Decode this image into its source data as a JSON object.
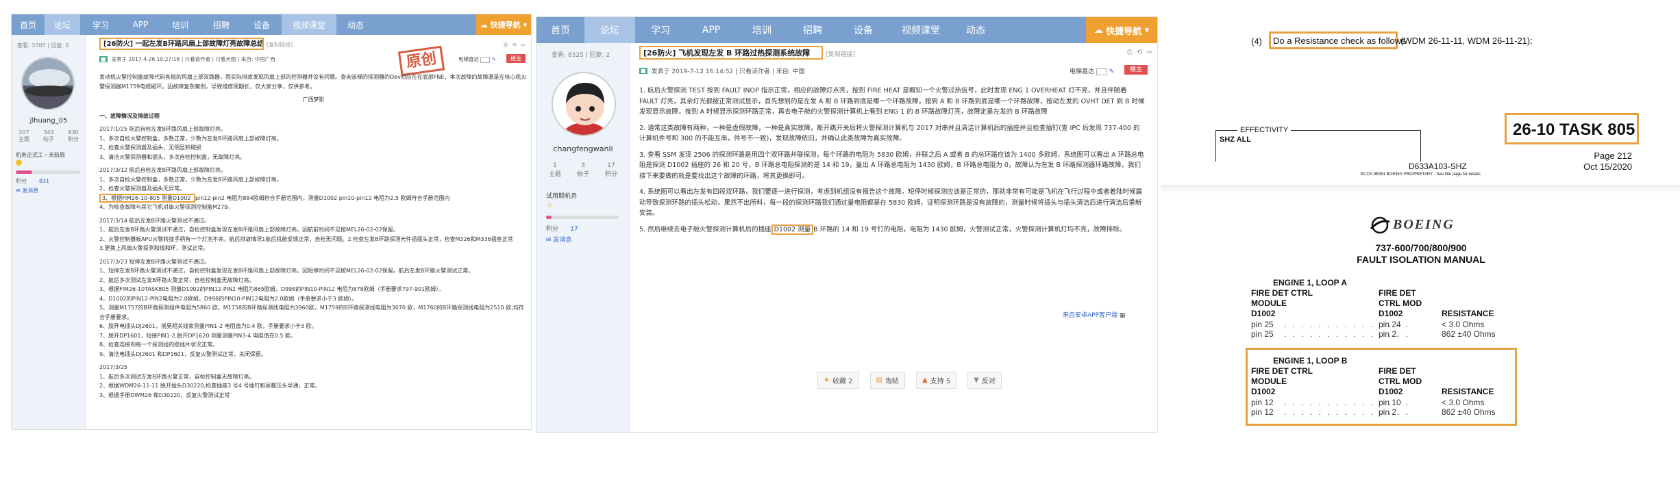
{
  "left_post": {
    "nav": [
      "首页",
      "论坛",
      "学习",
      "APP",
      "培训",
      "招聘",
      "设备",
      "视频课堂",
      "动态"
    ],
    "quick_nav": "快捷导航",
    "stats_line": "查看: 3705 | 回复: 6",
    "title": "[26防火] 一起左发B环路风扇上部故障灯亮故障总结",
    "copy_link": "[复制链接]",
    "meta": "发表于 2017-4-26 10:27:18 | 只看该作者 | 只看大图 | 来自: 中国广西",
    "stamp": "原创",
    "eyes": "电梯直达",
    "floor": "楼主",
    "username": "jlhuang_05",
    "stats": [
      {
        "v": "207",
        "l": "主题"
      },
      {
        "v": "343",
        "l": "帖子"
      },
      {
        "v": "830",
        "l": "积分"
      }
    ],
    "rank": "机务正式工・天航局",
    "credit_label": "积分",
    "credit_value": "831",
    "send_msg": "发消息",
    "intro": "发动机火警控制盒故障代码各报的风扇上部双路器，而实际排故发现风扇上部的控测器并没有问题。查询该梯的探测器的Dev对应在在底部FNE，本次故障的故障源是左核心机火警探测器M1759电缆磁环。因故障复杂案例，导致维修周期长，仅大家分享，仅供参考。",
    "sign": "广西梦影",
    "sections": [
      {
        "h": "一、故障情况及排故过程",
        "lines": []
      },
      {
        "h": "2017/1/25 航后自检左发B环路风扇上部故障灯亮。",
        "lines": [
          "1、多次自检火警控制盒，多数正常，少数为左发B环路风扇上部故障灯亮。",
          "2、检查火警探测器及插头，无明显积碳损",
          "3、清洁火警探测器和插头，多次自检控制盒，无故障灯亮。"
        ]
      },
      {
        "h": "2017/3/12 航后自检左发B环路风扇上部故障灯亮。",
        "lines": [
          "1、多次自检火警控制盒，多数正常，少数为左发B环路风扇上部故障灯亮。",
          "2、检查火警探测器及插头无异常。",
          "3、根据FIM26-10-805 测量D1002 pin12-pin2 电阻为884欧姆符合手册范围内，测量D1002 pin10-pin12 电阻为2.5 欧姆符合手册范围内",
          "4、为核查故障与其它飞机对串火警探测控制盒M279。"
        ]
      },
      {
        "h": "2017/3/14 航后左发B环路火警测试不通过。",
        "lines": [
          "1、航后左发B环路火警测试不通过，自检控制盒发现左发B环路风扇上部故障灯亮，因航前时间不足按MEL26-02-02保留。",
          "2、火警控制器板APU火警转技手柄有一个灯泡不亮，航后排故情况1航后机舱反馈正常，自检无问题。2.检查左发B环路探测元件插插头正常，检查M326和M336插座正常",
          "3.更换上风扇火警探测和线和环，测试正常。"
        ]
      },
      {
        "h": "2017/3/23 短停左发B环路火警测试不通过。",
        "lines": [
          "1、短停左发B环路火警测试不通过，自检控制盒发现左发B环路风扇上部故障灯亮，因短停时间不足按MEL26-02-02保留。航后左发B环路火警测试正常。",
          "2、航后多次测试左发B环路火警正常，自检控制盒无故障灯亮。",
          "3、根据FIM26-10TASK805 测量D1002的PIN12-PIN2 电阻为865欧姆，D998的PIN10-PIN12 电阻为878欧姆（手册要求797-901欧姆）。",
          "4、D1002的PIN12-PIN2电阻为2.0欧姆，D998的PIN10-PIN12电阻为2.0欧姆（手册要求小于3 欧姆）。",
          "5、测量M1757的B环路探测组件电阻为5860 欧，M1758的B环路探测线电阻为3960欧，M1759的B环路探测线电阻为3070 欧，M1760的B环路探测线电阻为2510 欧,均符合手册要求。",
          "6、脱开电插头DJ2601，摇晃相关线束测量PIN1-2 电阻值为0.4 欧，手册要求小于3 欧。",
          "7、脱开DP1601，短接PIN1-2,脱开DP1620 测量测量PIN3-4 电阻值在0.5 欧。",
          "8、检查连接到每一个探测线的缆线片状况正常。",
          "9、清洁电插头DJ2601 和DP1601，反复火警测试正常，关闭保留。"
        ]
      },
      {
        "h": "2017/3/25",
        "lines": [
          "1、航后多次测试左发B环路火警正常，自检控制盒无故障灯亮。",
          "2、根据WDM26-11-11 脱开插头D30220,检查插座3 号4 号插钉和尿都压头导通，正常。",
          "3、根据手册DWM26 和D30220，反复火警测试正常"
        ]
      }
    ]
  },
  "mid_post": {
    "nav": [
      "首页",
      "论坛",
      "学习",
      "APP",
      "培训",
      "招聘",
      "设备",
      "视频课堂",
      "动态"
    ],
    "quick_nav": "快捷导航",
    "stats_line": "查看: 8325 | 回复: 2",
    "title": "[26防火] 飞机发现左发 B 环路过热探测系统故障",
    "copy_link": "[复制链接]",
    "meta": "发表于 2019-7-12 16:14:52 | 只看该作者 | 来自: 中国",
    "eyes": "电梯直达",
    "floor": "楼主",
    "username": "changfengwanli",
    "stats": [
      {
        "v": "1",
        "l": "主题"
      },
      {
        "v": "3",
        "l": "帖子"
      },
      {
        "v": "17",
        "l": "积分"
      }
    ],
    "rank": "试用期机务",
    "credit_label": "积分",
    "credit_value": "17",
    "send_msg": "发消息",
    "paragraphs": [
      "1. 航后火警探测 TEST 按到 FAULT INOP 指示正常，相应的故障灯点亮，按到 FIRE HEAT 是概知一个火警过热信号，此时发现 ENG 1 OVERHEAT 灯不亮，并且伴随着 FAULT 灯亮，其余灯光都按正常测试显示，首先想到的是左发 A 和 B 环路到底是哪一个环路故障，按到 A 和 B 环路到底是哪一个环路故障，按动左发的 OVHT DET 到 B 时候发现显示故障，按到 A 时候显示探测环路正常，再去电子舱的火警探测计算机上看到 ENG 1 的 B 环路故障灯亮，故障定是左发的 B 环路故障",
      "2. 通常这类故障有两种，一种是虚假故障，一种是真实故障，断开跳开关后将火警探测计算机与 2017 对串并且清洁计算机后的插座并且检查插钉(查 IPC 后发现 737-400 的计算机件号和 300 的不能互串，件号不一致)，发现故障依旧，并确认此类故障为真实故障。",
      "3. 查看 SSM 发现 2506 的探测环路是用四个双环路并联探测，每个环路的电阻为 5830 欧姆，并联之后 A 或者 B 的总环路应该为 1400 多欧姆，系统图可以看出 A 环路总电阻是探测 D1002 插座的 26 和 20 号，B 环路总电阻探测的是 14 和 19，量出 A 环路总电阻为 1430 欧姆，B 环路总电阻为 0，故障认为左发 B 环路探测器环路故障，我们接下来要做的就是要找出这个故障的环路，将其更换即可。",
      "4. 系统图可以看出左发有四段双环路，我们要逐一进行探测，考虑到机组没有报告这个故障，短停时候探测应该是正常的，那就非常有可能是飞机在飞行过程中或者着陆时候震动导致探测环路的插头松动，果然不出所料，每一段的探测环路我们通过量电阻都是在 5830 欧姆，证明探测环路是没有故障的，测量时候将插头与插头清洁后进行清洁后重新安装。"
    ],
    "p5_before": "5. 然后继续去电子舱火警探测计算机后的插座",
    "p5_hl": "D1002 测量",
    "p5_after": "B 环路的 14 和 19 号钉的电阻，电阻为 1430 欧姆，火警测试正常，火警探测计算机灯均不亮，故障排除。",
    "from_app": "来自安卓APP客户端",
    "actions": [
      "收藏 2",
      "淘帖",
      "支持 5",
      "反对"
    ]
  },
  "manual": {
    "step": "(4)",
    "step_hl": "Do a Resistance check as follows",
    "step_ref": "(WDM 26-11-11, WDM 26-11-21):",
    "effectivity": "EFFECTIVITY",
    "shz": "SHZ ALL",
    "task": "26-10  TASK 805",
    "docnum": "D633A103-SHZ",
    "page": "Page 212",
    "date": "Oct 15/2020",
    "proprietary": "ECCN 9E991 BOEING PROPRIETARY - See title page for details",
    "brand": "BOEING",
    "model": "737-600/700/800/900",
    "manual_title": "FAULT ISOLATION MANUAL",
    "loop_a": "ENGINE 1, LOOP A",
    "loop_b": "ENGINE 1, LOOP B",
    "col1": "FIRE DET CTRL",
    "col1b": "MODULE",
    "col2": "FIRE DET",
    "col2b": "CTRL MOD",
    "col3": "RESISTANCE",
    "plug": "D1002",
    "rows_a": [
      {
        "p1": "pin 25",
        "p2": "pin 24",
        "r": "< 3.0 Ohms"
      },
      {
        "p1": "pin 25",
        "p2": "pin 2",
        "r": "862 ±40 Ohms"
      }
    ],
    "rows_b": [
      {
        "p1": "pin 12",
        "p2": "pin 10",
        "r": "< 3.0 Ohms"
      },
      {
        "p1": "pin 12",
        "p2": "pin 2",
        "r": "862 ±40 Ohms"
      }
    ]
  }
}
